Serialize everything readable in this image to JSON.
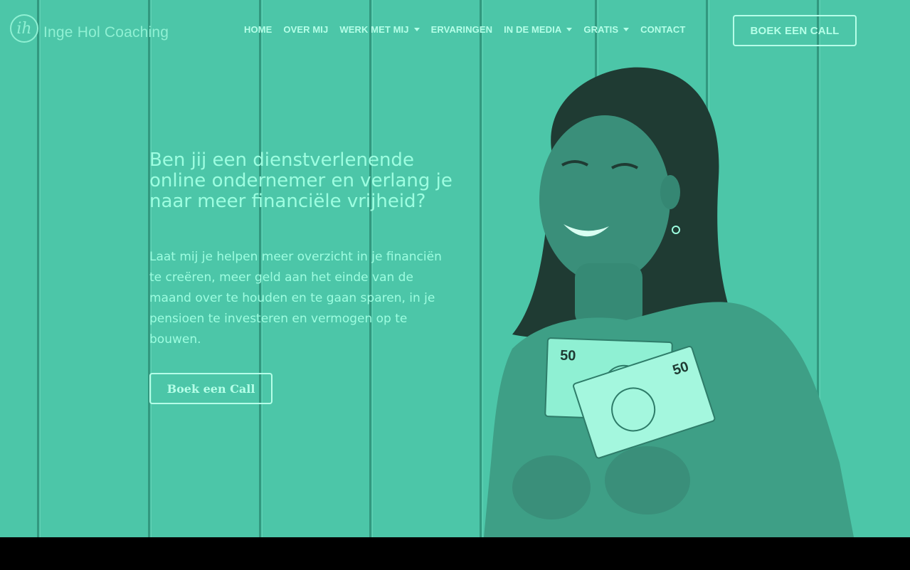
{
  "brand": {
    "logo_mark": "ih",
    "name": "Inge Hol Coaching"
  },
  "nav": {
    "items": [
      {
        "label": "HOME",
        "has_dropdown": false
      },
      {
        "label": "OVER MIJ",
        "has_dropdown": false
      },
      {
        "label": "WERK MET MIJ",
        "has_dropdown": true
      },
      {
        "label": "ERVARINGEN",
        "has_dropdown": false
      },
      {
        "label": "IN DE MEDIA",
        "has_dropdown": true
      },
      {
        "label": "GRATIS",
        "has_dropdown": true
      },
      {
        "label": "CONTACT",
        "has_dropdown": false
      }
    ],
    "cta_label": "BOEK EEN CALL"
  },
  "hero": {
    "headline": "Ben jij een dienstverlenende online ondernemer en verlang je naar meer financiële vrijheid?",
    "lead": "Laat mij je helpen meer overzicht in je financiën te creëren, meer geld aan het einde van de maand over te houden en te gaan sparen, in je pensioen te investeren en vermogen op te bouwen.",
    "cta_label": "Boek een Call",
    "banknote_value": "50"
  },
  "colors": {
    "overlay": "#4cc6a8",
    "text_light": "#9dfde0",
    "outline": "#b6ffe8",
    "footer_band": "#000000"
  }
}
